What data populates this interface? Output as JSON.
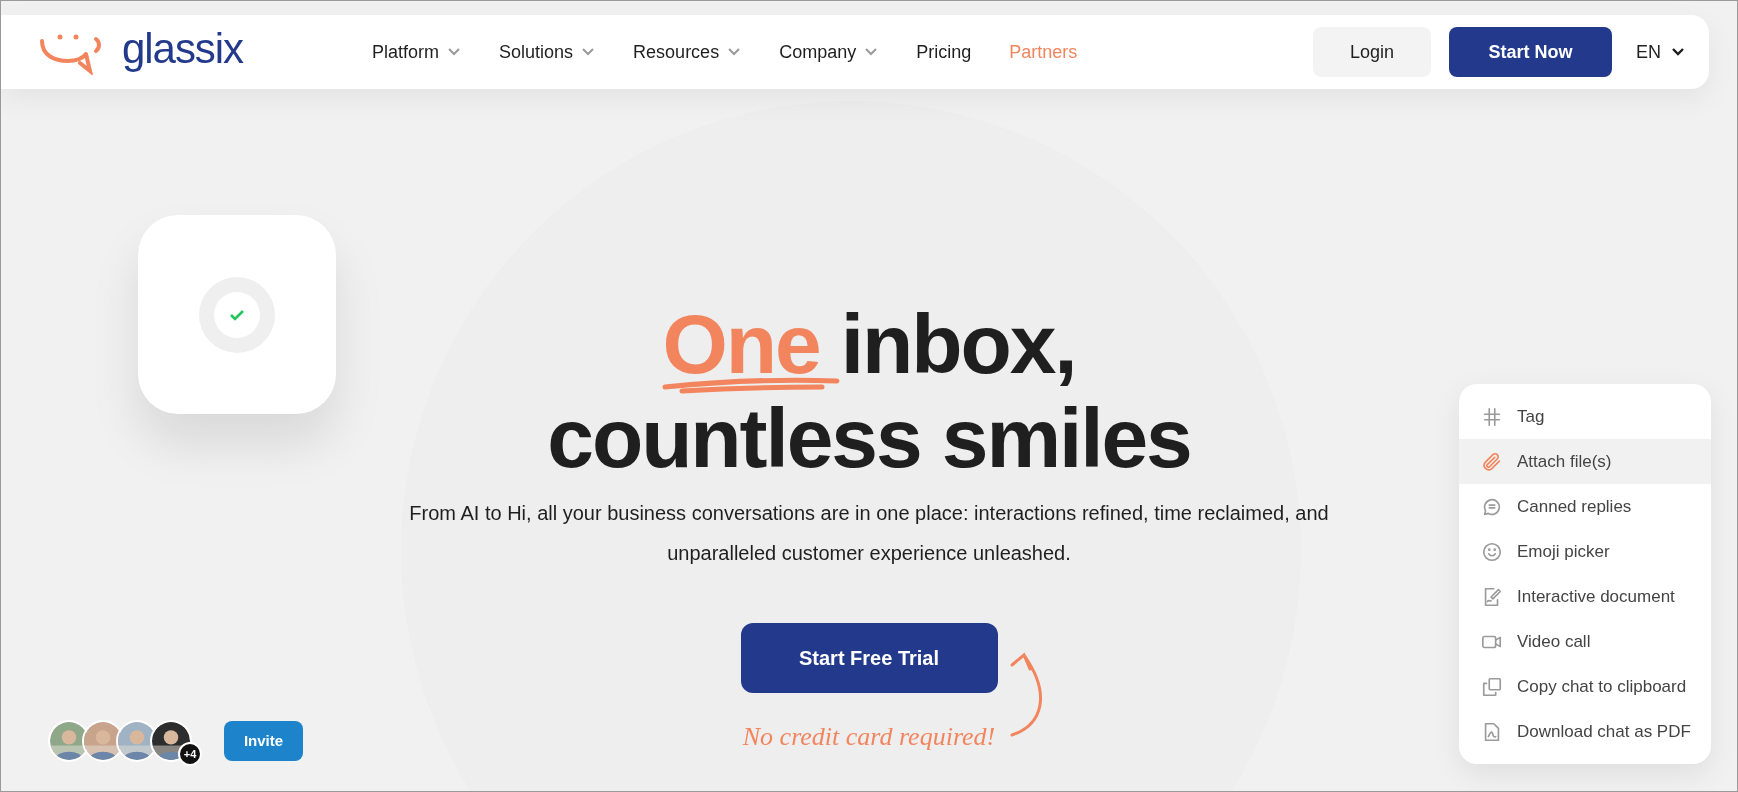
{
  "header": {
    "logo": "glassix",
    "nav": [
      {
        "label": "Platform",
        "dropdown": true,
        "selected": false
      },
      {
        "label": "Solutions",
        "dropdown": true,
        "selected": false
      },
      {
        "label": "Resources",
        "dropdown": true,
        "selected": false
      },
      {
        "label": "Company",
        "dropdown": true,
        "selected": false
      },
      {
        "label": "Pricing",
        "dropdown": false,
        "selected": false
      },
      {
        "label": "Partners",
        "dropdown": false,
        "selected": true
      }
    ],
    "login": "Login",
    "cta": "Start Now",
    "language": "EN"
  },
  "status_card": {
    "checked": true
  },
  "hero": {
    "headline_highlight": "One",
    "headline_rest": "inbox,",
    "headline_line2": "countless smiles",
    "subtitle": "From AI to Hi, all your business conversations are in one place: interactions refined, time reclaimed, and unparalleled customer experience unleashed.",
    "cta": "Start Free Trial",
    "note": "No credit card required!"
  },
  "team": {
    "extra_count": "+4",
    "button": "Invite"
  },
  "menu": {
    "items": [
      {
        "label": "Tag",
        "kind": "hash",
        "selected": false
      },
      {
        "label": "Attach file(s)",
        "kind": "clip",
        "selected": true
      },
      {
        "label": "Canned replies",
        "kind": "chat",
        "selected": false
      },
      {
        "label": "Emoji picker",
        "kind": "smile",
        "selected": false
      },
      {
        "label": "Interactive document",
        "kind": "doc",
        "selected": false
      },
      {
        "label": "Video call",
        "kind": "video",
        "selected": false
      },
      {
        "label": "Copy chat to clipboard",
        "kind": "copy",
        "selected": false
      },
      {
        "label": "Download chat as PDF",
        "kind": "pdf",
        "selected": false
      }
    ]
  }
}
